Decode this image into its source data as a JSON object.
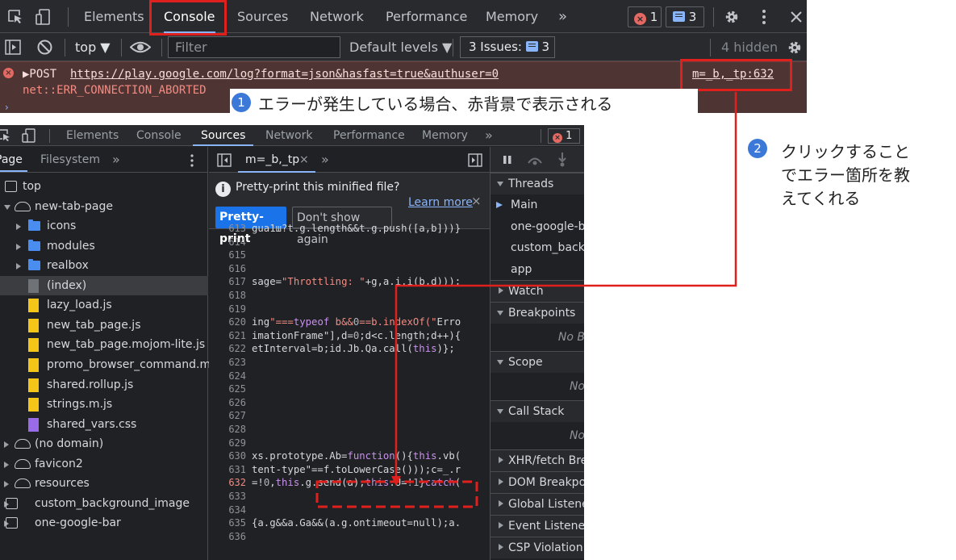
{
  "console_panel": {
    "tabs": [
      "Elements",
      "Console",
      "Sources",
      "Network",
      "Performance",
      "Memory"
    ],
    "active_tab": "Console",
    "more_tabs": "»",
    "error_count": "1",
    "message_count": "3",
    "context": "top ▼",
    "filter_placeholder": "Filter",
    "levels": "Default levels ▼",
    "issues_label": "3 Issues:",
    "issues_count": "3",
    "hidden": "4 hidden",
    "error_method": "▶POST",
    "error_url": "https://play.google.com/log?format=json&hasfast=true&authuser=0",
    "error_source": "m=_b,_tp:632",
    "error_text": "net::ERR_CONNECTION_ABORTED"
  },
  "annotations": {
    "one_num": "1",
    "one_text": "エラーが発生している場合、赤背景で表示される",
    "two_num": "2",
    "two_lines": [
      "クリックすること",
      "でエラー箇所を教",
      "えてくれる"
    ],
    "color": "#e0201c"
  },
  "sources_panel": {
    "tabs": [
      "Elements",
      "Console",
      "Sources",
      "Network",
      "Performance",
      "Memory"
    ],
    "active_tab": "Sources",
    "more_tabs": "»",
    "error_count": "1",
    "nav_tabs": [
      "Page",
      "Filesystem",
      "»"
    ],
    "tree": [
      {
        "label": "top",
        "icon": "frame"
      },
      {
        "label": "new-tab-page",
        "icon": "cloud"
      },
      {
        "label": "icons",
        "icon": "folder"
      },
      {
        "label": "modules",
        "icon": "folder"
      },
      {
        "label": "realbox",
        "icon": "folder"
      },
      {
        "label": "(index)",
        "icon": "file-gray"
      },
      {
        "label": "lazy_load.js",
        "icon": "file-js"
      },
      {
        "label": "new_tab_page.js",
        "icon": "file-js"
      },
      {
        "label": "new_tab_page.mojom-lite.js",
        "icon": "file-js"
      },
      {
        "label": "promo_browser_command.moj",
        "icon": "file-js"
      },
      {
        "label": "shared.rollup.js",
        "icon": "file-js"
      },
      {
        "label": "strings.m.js",
        "icon": "file-js"
      },
      {
        "label": "shared_vars.css",
        "icon": "file-css"
      },
      {
        "label": "(no domain)",
        "icon": "cloud"
      },
      {
        "label": "favicon2",
        "icon": "cloud"
      },
      {
        "label": "resources",
        "icon": "cloud"
      },
      {
        "label": "custom_background_image",
        "icon": "frame"
      },
      {
        "label": "one-google-bar",
        "icon": "frame"
      }
    ],
    "editor_tab": "m=_b,_tp",
    "editor_more": "»",
    "prettyprint_question": "Pretty-print this minified file?",
    "learn_more": "Learn more",
    "prettyprint_button": "Pretty-print",
    "dont_show_button": "Don't show again",
    "code_lines": [
      {
        "n": "613",
        "t": "gua1ш?t.g.length&&t.g.push([a,b]))}"
      },
      {
        "n": "614",
        "t": ""
      },
      {
        "n": "615",
        "t": ""
      },
      {
        "n": "616",
        "t": ""
      },
      {
        "n": "617",
        "t": "sage=\"Throttling: \"+g,a.i.i(b,d)));"
      },
      {
        "n": "618",
        "t": ""
      },
      {
        "n": "619",
        "t": ""
      },
      {
        "n": "620",
        "t": "ing\"===typeof b&&0==b.indexOf(\"Erro"
      },
      {
        "n": "621",
        "t": "imationFrame\"],d=0;d<c.length;d++){"
      },
      {
        "n": "622",
        "t": "etInterval=b;id.Jb.Qa.call(this)};"
      },
      {
        "n": "623",
        "t": ""
      },
      {
        "n": "624",
        "t": ""
      },
      {
        "n": "625",
        "t": ""
      },
      {
        "n": "626",
        "t": ""
      },
      {
        "n": "627",
        "t": ""
      },
      {
        "n": "628",
        "t": ""
      },
      {
        "n": "629",
        "t": ""
      },
      {
        "n": "630",
        "t": "xs.prototype.Ab=function(){this.vb("
      },
      {
        "n": "631",
        "t": "tent-type\"==f.toLowerCase()));c=_.r"
      },
      {
        "n": "632",
        "t": "=!0,this.g.send(a),this.U=!1}catch("
      },
      {
        "n": "633",
        "t": ""
      },
      {
        "n": "634",
        "t": ""
      },
      {
        "n": "635",
        "t": "{a.g&&a.Ga&&(a.g.ontimeout=null);a."
      },
      {
        "n": "636",
        "t": ""
      }
    ],
    "debugger": {
      "threads": "Threads",
      "thread_items": [
        "Main",
        "one-google-b",
        "custom_backg",
        "app"
      ],
      "watch": "Watch",
      "breakpoints": "Breakpoints",
      "breakpoints_empty": "No B",
      "scope": "Scope",
      "scope_empty": "No",
      "call_stack": "Call Stack",
      "call_stack_empty": "No",
      "xhr": "XHR/fetch Brea",
      "dom": "DOM Breakpoi",
      "global": "Global Listener",
      "event": "Event Listener",
      "csp": "CSP Violation B"
    }
  }
}
